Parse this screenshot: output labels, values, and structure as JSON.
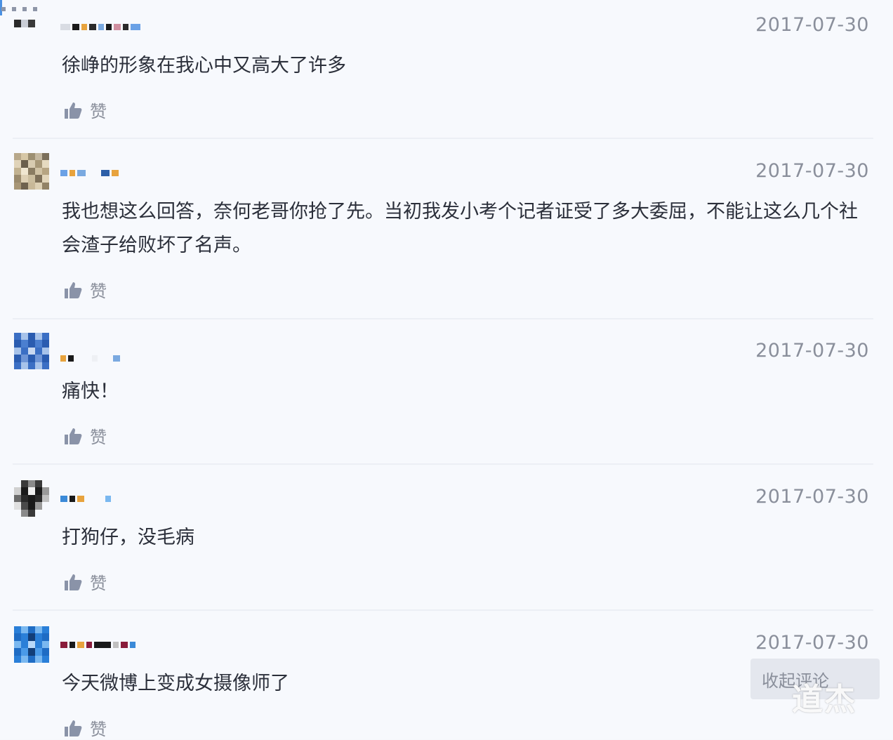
{
  "comments": [
    {
      "date": "2017-07-30",
      "text": "徐峥的形象在我心中又高大了许多",
      "like_label": "赞"
    },
    {
      "date": "2017-07-30",
      "text": "我也想这么回答，奈何老哥你抢了先。当初我发小考个记者证受了多大委屈，不能让这么几个社会渣子给败坏了名声。",
      "like_label": "赞"
    },
    {
      "date": "2017-07-30",
      "text": "痛快！",
      "like_label": "赞"
    },
    {
      "date": "2017-07-30",
      "text": "打狗仔，没毛病",
      "like_label": "赞"
    },
    {
      "date": "2017-07-30",
      "text": "今天微博上变成女摄像师了",
      "like_label": "赞"
    }
  ],
  "collapse_button": {
    "label": "收起评论"
  },
  "watermark": {
    "text": "道杰"
  },
  "icons": {
    "like": "thumbs-up-icon"
  },
  "colors": {
    "like_icon": "#8a93a8",
    "date": "#8a8f9b",
    "text": "#2b2f3a"
  }
}
